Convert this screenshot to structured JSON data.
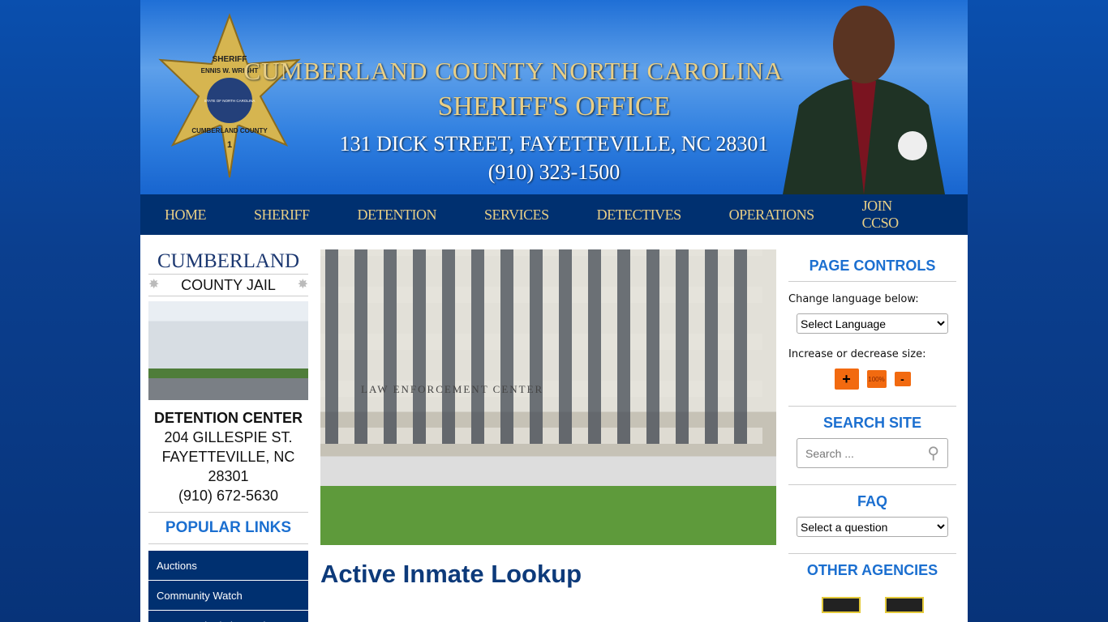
{
  "header": {
    "line1": "CUMBERLAND COUNTY NORTH CAROLINA",
    "line2": "SHERIFF'S OFFICE",
    "address": "131 DICK STREET, FAYETTEVILLE, NC 28301",
    "phone": "(910) 323-1500",
    "badge_text": [
      "SHERIFF",
      "ENNIS W. WRIGHT",
      "STATE OF NORTH CAROLINA",
      "CUMBERLAND COUNTY",
      "1"
    ]
  },
  "nav": [
    "HOME",
    "SHERIFF",
    "DETENTION",
    "SERVICES",
    "DETECTIVES",
    "OPERATIONS",
    "JOIN CCSO"
  ],
  "left": {
    "title1": "CUMBERLAND",
    "title2": "COUNTY JAIL",
    "name": "DETENTION CENTER",
    "street": "204 GILLESPIE ST.",
    "city": "FAYETTEVILLE, NC",
    "zip": "28301",
    "phone": "(910) 672-5630",
    "links_title": "POPULAR LINKS",
    "links": [
      "Auctions",
      "Community Watch",
      "Gun Permits / Fingerprints"
    ]
  },
  "center": {
    "photo_sign": "LAW ENFORCEMENT CENTER",
    "heading": "Active Inmate Lookup"
  },
  "right": {
    "controls_title": "PAGE CONTROLS",
    "language_label": "Change language below:",
    "language_select": "Select Language",
    "size_label": "Increase or decrease size:",
    "plus": "+",
    "reset": "100%",
    "minus": "-",
    "search_title": "SEARCH SITE",
    "search_placeholder": "Search ...",
    "faq_title": "FAQ",
    "faq_select": "Select a question",
    "agencies_title": "OTHER AGENCIES"
  },
  "colors": {
    "navy": "#003070",
    "gold": "#e9cf86",
    "link_blue": "#1b6fd0",
    "orange": "#f26a10"
  }
}
